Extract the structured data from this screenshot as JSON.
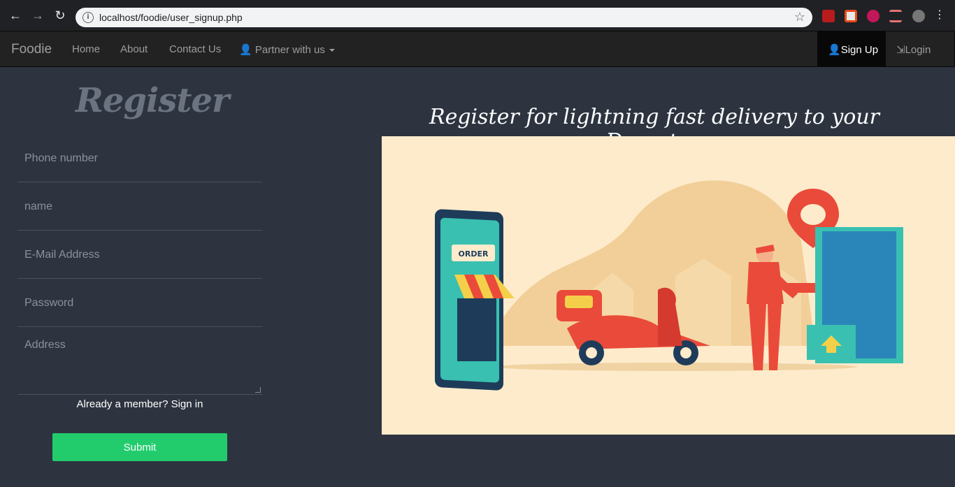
{
  "browser": {
    "url": "localhost/foodie/user_signup.php"
  },
  "navbar": {
    "brand": "Foodie",
    "links": [
      {
        "label": "Home"
      },
      {
        "label": "About"
      },
      {
        "label": "Contact Us"
      },
      {
        "label": "Partner with us"
      }
    ],
    "signup_label": "Sign Up",
    "login_label": "Login"
  },
  "form": {
    "title": "Register",
    "phone_placeholder": "Phone number",
    "name_placeholder": "name",
    "email_placeholder": "E-Mail Address",
    "password_placeholder": "Password",
    "address_placeholder": "Address",
    "signin_text": "Already a member? Sign in",
    "submit_label": "Submit"
  },
  "hero": {
    "title": "Register for lightning fast delivery to your Doorstep",
    "order_label": "ORDER"
  },
  "colors": {
    "page_bg": "#2d3440",
    "submit": "#22cc6d",
    "hero_bg": "#fdebcc"
  }
}
